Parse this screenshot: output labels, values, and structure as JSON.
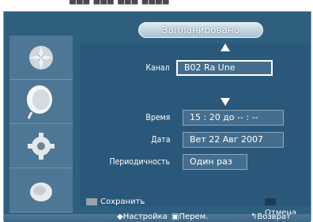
{
  "dialog": {
    "title": "Запланировано"
  },
  "form": {
    "channel_label": "Канал",
    "channel_value": "B02 Ra Une",
    "time_label": "Время",
    "time_value": "15 : 20 до -- : --",
    "date_label": "Дата",
    "date_value": "Вет 22 Авг 2007",
    "repeat_label": "Периодичность",
    "repeat_value": "Один раз"
  },
  "buttons": {
    "save_label": "Сохранить",
    "save_color": "#9aa3aa",
    "cancel_label": "Отмена",
    "cancel_color": "#1e3a54"
  },
  "footer": {
    "setup_label": "Настройка",
    "move_label": "Перем.",
    "return_label": "Возврат"
  },
  "icons": [
    "picture-icon",
    "sound-icon",
    "setup-icon",
    "input-icon"
  ]
}
